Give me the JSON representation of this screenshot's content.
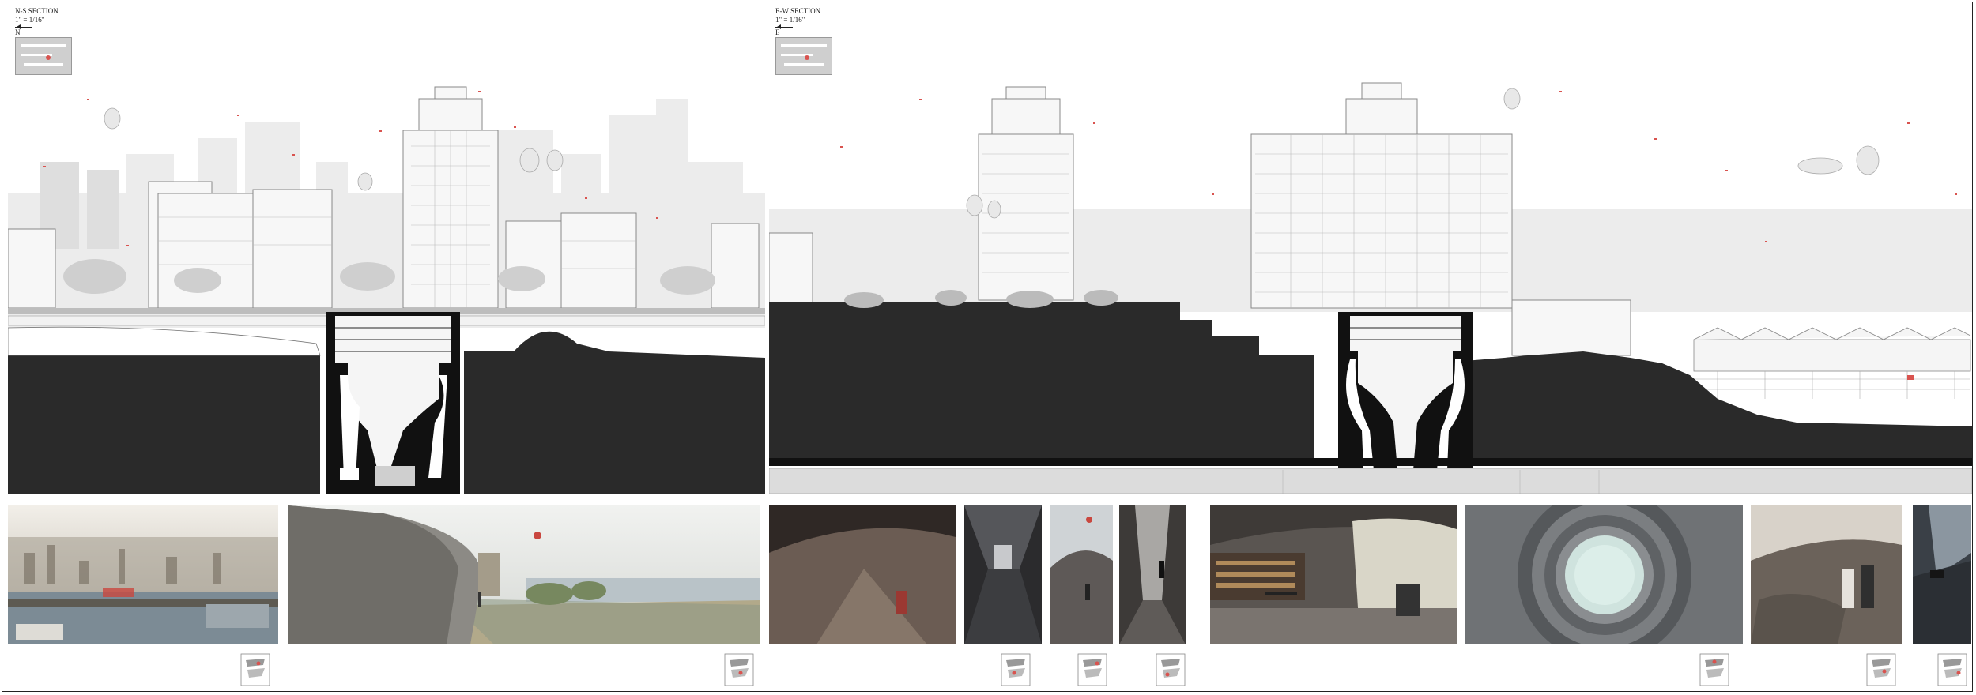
{
  "left_panel": {
    "title": "N-S SECTION",
    "scale": "1\" = 1/16\"",
    "direction": "N"
  },
  "right_panel": {
    "title": "E-W SECTION",
    "scale": "1\" = 1/16\"",
    "direction": "E"
  },
  "colors": {
    "ground": "#2a2a2a",
    "accent": "#d9534f",
    "sky_buildings": "#e6e6e6"
  }
}
